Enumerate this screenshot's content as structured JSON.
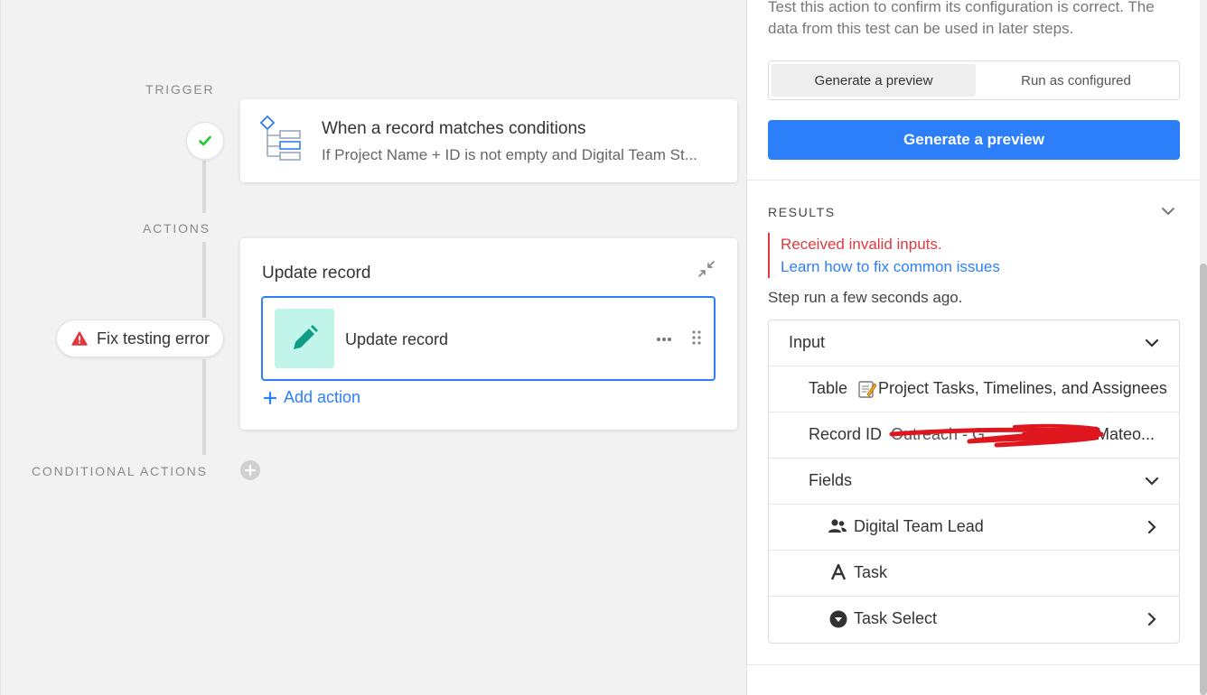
{
  "canvas": {
    "trigger_label": "TRIGGER",
    "actions_label": "ACTIONS",
    "conditional_label": "CONDITIONAL ACTIONS",
    "trigger_card": {
      "title": "When a record matches conditions",
      "subtitle": "If Project Name + ID is not empty and Digital Team St..."
    },
    "action_card": {
      "title": "Update record",
      "step_label": "Update record",
      "add_action": "Add action"
    },
    "fix_error": "Fix testing error"
  },
  "panel": {
    "description": "Test this action to confirm its configuration is correct. The data from this test can be used in later steps.",
    "segments": [
      "Generate a preview",
      "Run as configured"
    ],
    "primary_button": "Generate a preview",
    "results_label": "RESULTS",
    "error_message": "Received invalid inputs.",
    "error_link": "Learn how to fix common issues",
    "step_run": "Step run a few seconds ago.",
    "input": {
      "header": "Input",
      "table_label": "Table",
      "table_value": "Project Tasks, Timelines, and Assignees",
      "record_id_label": "Record ID",
      "record_id_value_start": "Outreach - G",
      "record_id_value_end": "Mateo...",
      "fields_label": "Fields",
      "fields": [
        {
          "label": "Digital Team Lead",
          "icon": "users-icon"
        },
        {
          "label": "Task",
          "icon": "text-a-icon"
        },
        {
          "label": "Task Select",
          "icon": "select-chevron-icon"
        }
      ]
    }
  },
  "colors": {
    "accent": "#2d7ff9",
    "error": "#e0383e",
    "success": "#20c933",
    "pencil_bg": "#c2f5e9",
    "pencil_fg": "#0f9d86"
  }
}
